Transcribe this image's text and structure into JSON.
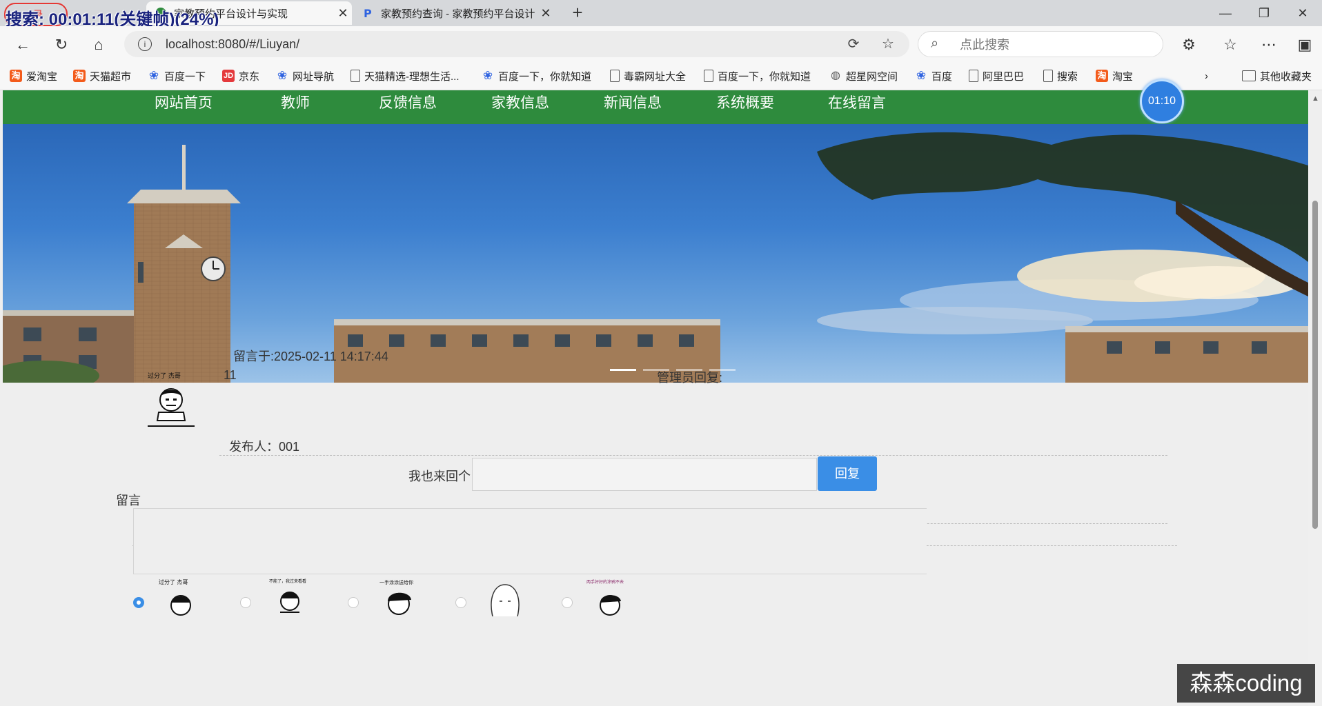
{
  "overlay": {
    "recording_text": "搜索: 00:01:11(关键帧)(24%)",
    "record_label": "录"
  },
  "browser": {
    "tabs": [
      {
        "title": "家教预约平台设计与实现",
        "active": true
      },
      {
        "title": "家教预约查询 - 家教预约平台设计",
        "active": false
      }
    ],
    "url": "localhost:8080/#/Liuyan/",
    "search_placeholder": "点此搜索",
    "bookmarks": [
      {
        "label": "爱淘宝",
        "icon": "taobao-icon"
      },
      {
        "label": "天猫超市",
        "icon": "taobao-icon"
      },
      {
        "label": "百度一下",
        "icon": "baidu-paw-icon"
      },
      {
        "label": "京东",
        "icon": "jd-icon"
      },
      {
        "label": "网址导航",
        "icon": "baidu-paw-icon"
      },
      {
        "label": "天猫精选-理想生活...",
        "icon": "page-icon"
      },
      {
        "label": "百度一下，你就知道",
        "icon": "baidu-paw-icon"
      },
      {
        "label": "毒霸网址大全",
        "icon": "page-icon"
      },
      {
        "label": "百度一下，你就知道",
        "icon": "page-icon"
      },
      {
        "label": "超星网空间",
        "icon": "globe-icon"
      },
      {
        "label": "百度",
        "icon": "baidu-paw-icon"
      },
      {
        "label": "阿里巴巴",
        "icon": "page-icon"
      },
      {
        "label": "搜索",
        "icon": "page-icon"
      },
      {
        "label": "淘宝",
        "icon": "taobao-icon"
      }
    ],
    "other_bookmarks": "其他收藏夹"
  },
  "site": {
    "menu": [
      "网站首页",
      "教师",
      "反馈信息",
      "家教信息",
      "新闻信息",
      "系统概要",
      "在线留言"
    ],
    "timer": "01:10",
    "accent_color": "#2e8b3d"
  },
  "message": {
    "time_label": "留言于:2025-02-11 14:17:44",
    "content": "11",
    "admin_reply_label": "管理员回复:",
    "author_label": "发布人：001",
    "reply_prompt": "我也来回个",
    "reply_button": "回复",
    "leave_message_label": "留言",
    "avatar_caption": "过分了 杰哥"
  },
  "emoji_options": [
    {
      "caption": "过分了 杰哥",
      "selected": true
    },
    {
      "caption": "不能了，我过来看看",
      "selected": false
    },
    {
      "caption": "一手涂涂送给你",
      "selected": false
    },
    {
      "caption": "",
      "selected": false
    },
    {
      "caption": "两手好好的涂鸦不去",
      "selected": false
    }
  ],
  "watermark": "森森coding"
}
